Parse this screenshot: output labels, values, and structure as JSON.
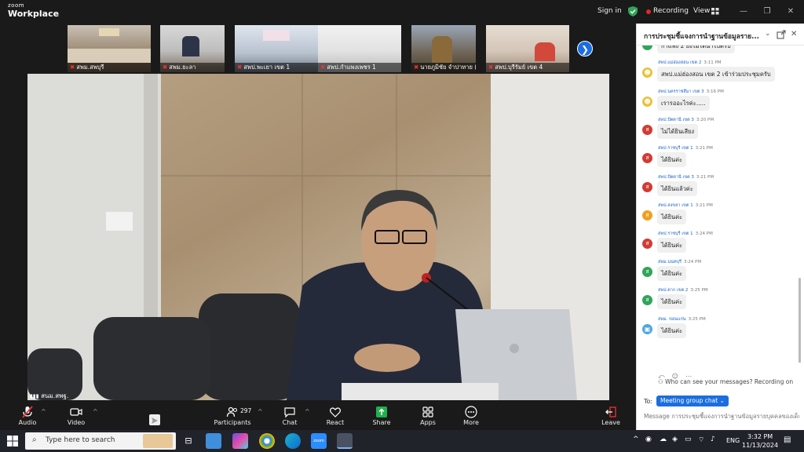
{
  "app": {
    "logo_top": "zoom",
    "logo_bottom": "Workplace",
    "sign_in": "Sign in",
    "recording": "Recording",
    "view": "View"
  },
  "thumbnails": [
    {
      "label": "สพม.สพบุรี"
    },
    {
      "label": "สพม.ยะลา"
    },
    {
      "label": "สพป.พะเยา เขต 1"
    },
    {
      "label": "สพป.กำแพงเพชร 1"
    },
    {
      "label": "นายภูมิชัย  จำปาทาย (รอ..."
    },
    {
      "label": "สพป.บุรีรัมย์ เขต 4"
    }
  ],
  "main_video": {
    "speaker_label": "สนม.สพฐ."
  },
  "toolbar": {
    "audio": "Audio",
    "video": "Video",
    "participants": "Participants",
    "participants_count": "297",
    "chat": "Chat",
    "react": "React",
    "share": "Share",
    "apps": "Apps",
    "more": "More",
    "leave": "Leave"
  },
  "chat": {
    "title": "การประชุมชี้แจงการนำฐานข้อมูลราย...",
    "top_partial": "กำแพง 2 ยังไม่ได้นำไปตรับ",
    "messages": [
      {
        "sender": "สพป.แม่ฮ่องสอน เขต 2",
        "time": "3:11 PM",
        "text": "สพป.แม่ฮ่องสอน เขต 2 เข้าร่วมประชุมครับ",
        "avatar": "",
        "color": "#e8c23a"
      },
      {
        "sender": "สพป.นครราชสีมา เขต 3",
        "time": "3:16 PM",
        "text": "เรารออะไรค่ะ.....",
        "avatar": "",
        "color": "#e8c23a"
      },
      {
        "sender": "สพป.ปัตตานี เขต 3",
        "time": "3:20 PM",
        "text": "ไม่ได้ยินเสียง",
        "avatar": "ส",
        "color": "#d23b35"
      },
      {
        "sender": "สพป.ราชบุรี เขต 1",
        "time": "3:21 PM",
        "text": "ได้ยินค่ะ",
        "avatar": "ส",
        "color": "#d23b35"
      },
      {
        "sender": "สพป.ปัตตานี เขต 3",
        "time": "3:21 PM",
        "text": "ได้ยินแล้วค่ะ",
        "avatar": "ส",
        "color": "#d23b35"
      },
      {
        "sender": "สพป.สงขลา เขต 1",
        "time": "3:21 PM",
        "text": "ได้ยินค่ะ",
        "avatar": "ส",
        "color": "#f0a020"
      },
      {
        "sender": "สพป.ราชบุรี เขต 1",
        "time": "3:24 PM",
        "text": "ได้ยินค่ะ",
        "avatar": "ส",
        "color": "#d23b35"
      },
      {
        "sender": "สพม.นนทบุรี",
        "time": "3:24 PM",
        "text": "ได้ยินค่ะ",
        "avatar": "ส",
        "color": "#2fa55a"
      },
      {
        "sender": "สพป.ตาก เขต 2",
        "time": "3:25 PM",
        "text": "ได้ยินค่ะ",
        "avatar": "ส",
        "color": "#2fa55a"
      },
      {
        "sender": "สพม. ขอนแก่น",
        "time": "3:25 PM",
        "text": "ได้ยินค่ะ",
        "avatar": "",
        "color": "#4aa8e0"
      }
    ],
    "notice": "Who can see your messages? Recording on",
    "to_label": "To:",
    "to_value": "Meeting group chat",
    "input_placeholder": "Message การประชุมชี้แจงการนำฐานข้อมูลรายบุคคลของเด็กน..."
  },
  "taskbar": {
    "search_placeholder": "Type here to search",
    "lang": "ENG",
    "time": "3:32 PM",
    "date": "11/13/2024"
  },
  "colors": {
    "accent": "#1a6ee0",
    "record": "#e02828",
    "share": "#22b04a"
  }
}
